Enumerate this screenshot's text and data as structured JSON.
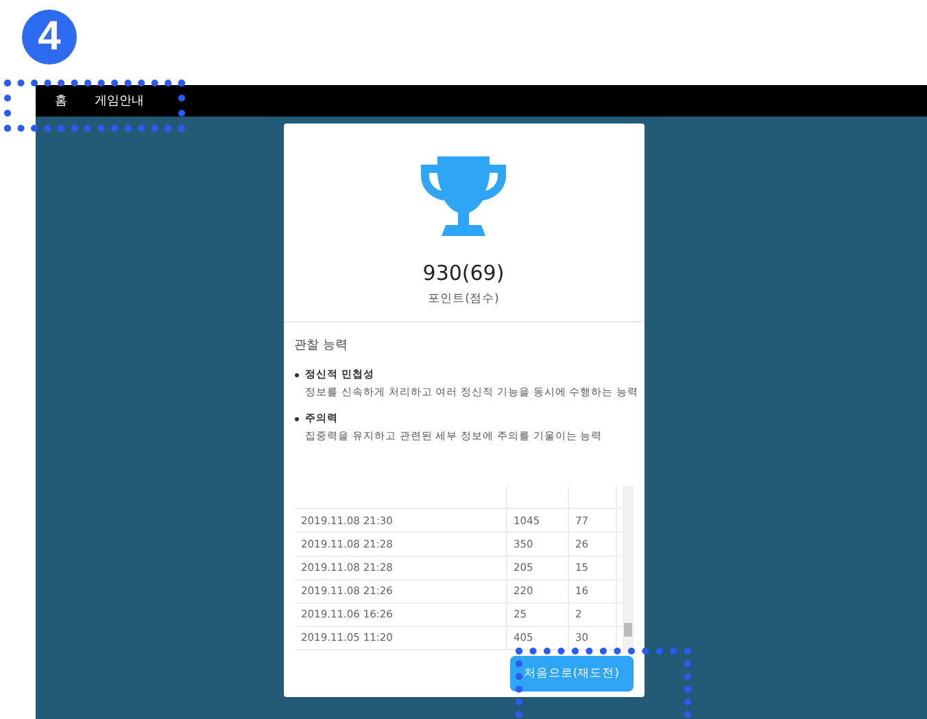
{
  "step_badge": "4",
  "nav": {
    "items": [
      {
        "label": "홈"
      },
      {
        "label": "게임안내"
      }
    ]
  },
  "result": {
    "score": "930(69)",
    "score_label": "포인트(점수)"
  },
  "abilities": {
    "title": "관찰 능력",
    "items": [
      {
        "name": "정신적 민첩성",
        "description": "정보를 신속하게 처리하고 여러 정신적 기능을 동시에 수행하는 능력"
      },
      {
        "name": "주의력",
        "description": "집중력을 유지하고 관련된 세부 정보에 주의를 기울이는 능력"
      }
    ]
  },
  "history": {
    "rows": [
      [
        "2019.11.08 21:30",
        "1045",
        "77"
      ],
      [
        "2019.11.08 21:28",
        "350",
        "26"
      ],
      [
        "2019.11.08 21:28",
        "205",
        "15"
      ],
      [
        "2019.11.08 21:26",
        "220",
        "16"
      ],
      [
        "2019.11.06 16:26",
        "25",
        "2"
      ],
      [
        "2019.11.05 11:20",
        "405",
        "30"
      ]
    ]
  },
  "restart_button": "처음으로(재도전)"
}
